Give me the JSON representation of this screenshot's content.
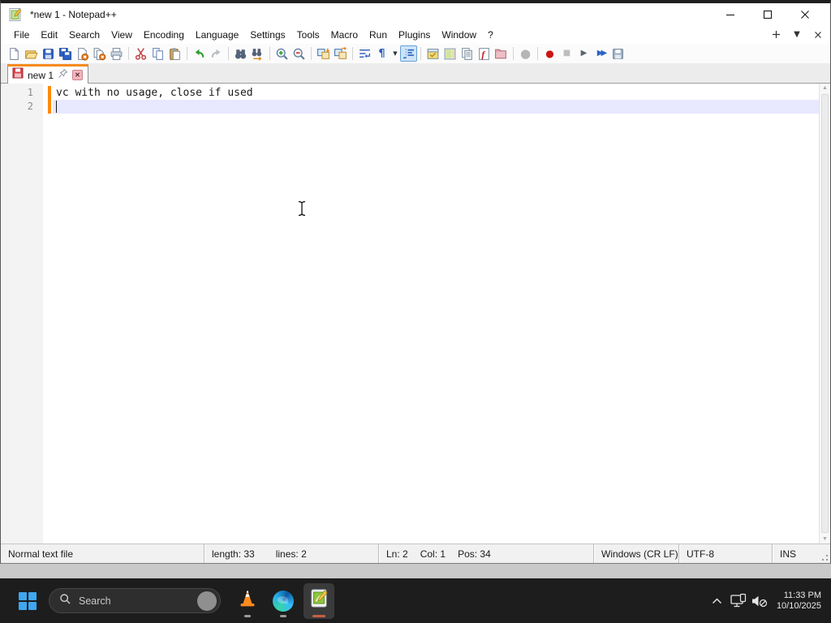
{
  "titlebar": {
    "title": "*new 1 - Notepad++",
    "icon": "notepad-plus-plus-logo",
    "controls": [
      "minimize",
      "maximize",
      "close"
    ]
  },
  "menubar": {
    "items": [
      "File",
      "Edit",
      "Search",
      "View",
      "Encoding",
      "Language",
      "Settings",
      "Tools",
      "Macro",
      "Run",
      "Plugins",
      "Window",
      "?"
    ],
    "tab_controls": {
      "new_tab": "+",
      "tab_list": "▼",
      "close_tab": "✕"
    }
  },
  "toolbar": {
    "groups": [
      [
        "new-file",
        "open-file",
        "save-file",
        "save-all",
        "close-file",
        "close-all",
        "print"
      ],
      [
        "cut",
        "copy",
        "paste"
      ],
      [
        "undo",
        "redo"
      ],
      [
        "find",
        "replace"
      ],
      [
        "zoom-in",
        "zoom-out"
      ],
      [
        "sync-vertical-scrolling",
        "sync-horizontal-scrolling"
      ],
      [
        "word-wrap",
        "show-all-characters",
        "show-all-characters-dropdown",
        "indent-guide"
      ],
      [
        "define-language",
        "document-map",
        "document-list",
        "function-list",
        "folder-as-workspace"
      ],
      [
        "monitoring"
      ],
      [
        "macro-record",
        "macro-stop",
        "macro-playback",
        "macro-run-multiple",
        "macro-save"
      ]
    ],
    "states": {
      "active": [
        "indent-guide"
      ],
      "disabled": [
        "redo",
        "macro-stop",
        "monitoring"
      ]
    }
  },
  "tabbar": {
    "active_tab": {
      "label": "new 1",
      "modified": true,
      "icons": [
        "modified-floppy",
        "pin",
        "close"
      ]
    }
  },
  "editor": {
    "lines": [
      {
        "number": "1",
        "text": "vc with no usage, close if used"
      },
      {
        "number": "2",
        "text": ""
      }
    ],
    "current_line": 2,
    "caret": {
      "line": 2,
      "col": 1
    },
    "modified_marker_lines": [
      1,
      2
    ]
  },
  "statusbar": {
    "doc_type": "Normal text file",
    "length": "length: 33",
    "lines": "lines: 2",
    "ln": "Ln: 2",
    "col": "Col: 1",
    "pos": "Pos: 34",
    "eol": "Windows (CR LF)",
    "encoding": "UTF-8",
    "mode": "INS"
  },
  "taskbar": {
    "search": {
      "placeholder": "Search",
      "icon": "search-magnifier"
    },
    "apps": [
      {
        "name": "vlc",
        "active": false
      },
      {
        "name": "edge",
        "active": false
      },
      {
        "name": "notepad-plus-plus",
        "active": true
      }
    ],
    "tray": {
      "icons": [
        "chevron-up",
        "display-device",
        "volume-muted"
      ],
      "time": "11:33 PM",
      "date": "10/10/2025"
    }
  },
  "colors": {
    "tab_accent_orange": "#f68b1f",
    "current_line_highlight": "#e8e8ff",
    "modified_marker_orange": "#ff8a00",
    "taskbar_background": "#1d1d1d",
    "active_app_indicator": "#c65f46",
    "toolbar_active_bg": "#cde4f7"
  }
}
